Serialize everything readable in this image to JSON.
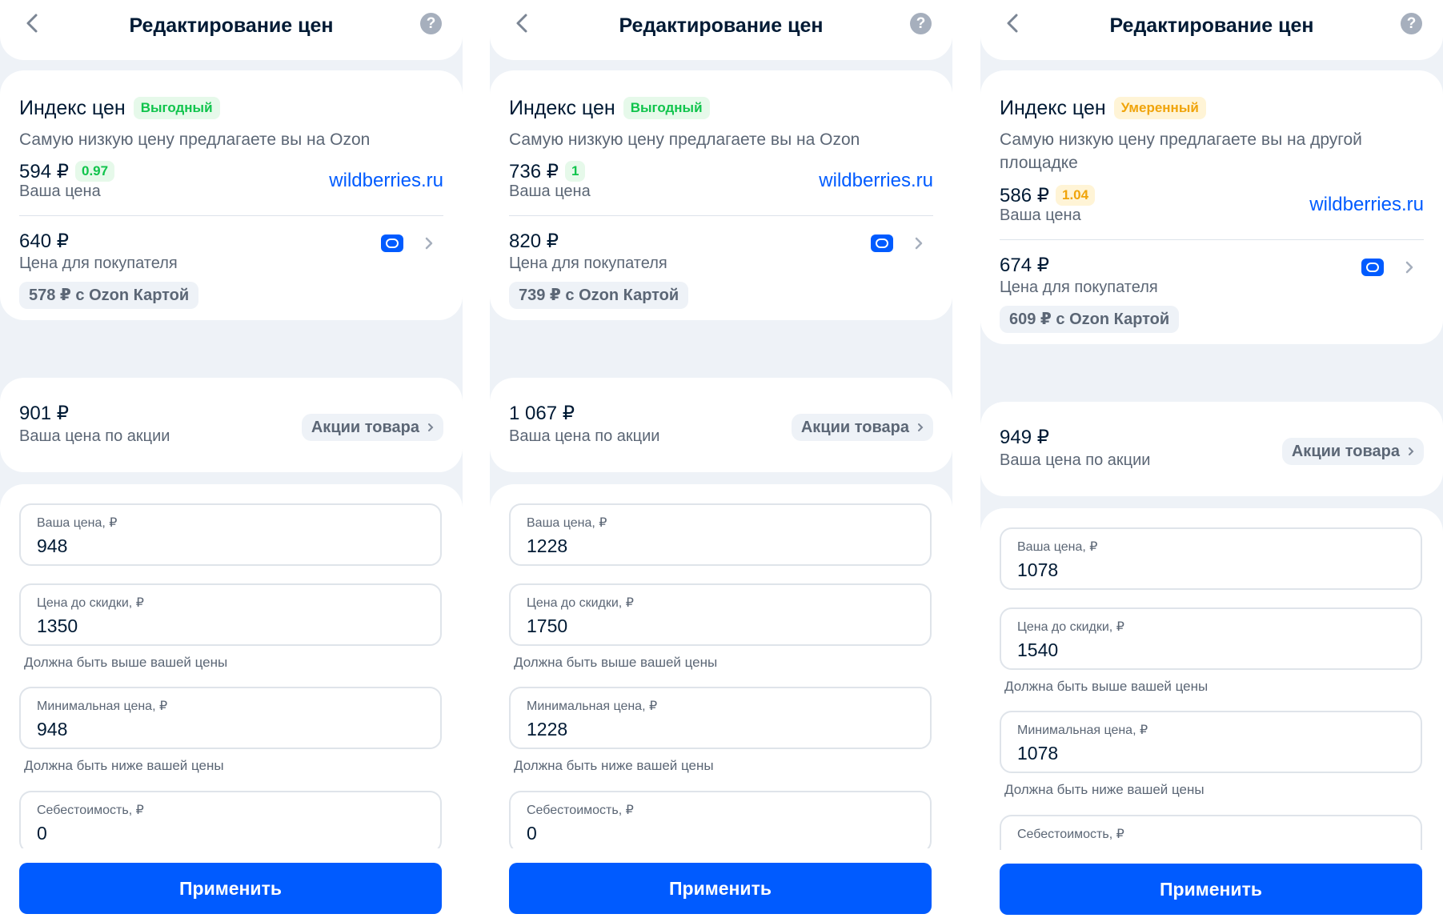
{
  "screens": [
    {
      "header": {
        "title": "Редактирование цен",
        "help_label": "?"
      },
      "price_index": {
        "label": "Индекс цен",
        "status": "Выгодный",
        "description": "Самую низкую цену предлагаете вы на Ozon"
      },
      "your_price": {
        "value": "594 ₽",
        "coef": "0.97",
        "label": "Ваша цена",
        "competitor": "wildberries.ru"
      },
      "buyer_price": {
        "value": "640 ₽",
        "label": "Цена для покупателя",
        "card_price": "578 ₽ с Ozon Картой"
      },
      "promo": {
        "value": "901 ₽",
        "label": "Ваша цена по акции",
        "button": "Акции товара"
      },
      "form": {
        "your_price_label": "Ваша цена, ₽",
        "your_price_value": "948",
        "before_discount_label": "Цена до скидки, ₽",
        "before_discount_value": "1350",
        "before_discount_hint": "Должна быть выше вашей цены",
        "min_price_label": "Минимальная цена, ₽",
        "min_price_value": "948",
        "min_price_hint": "Должна быть ниже вашей цены",
        "cost_label": "Себестоимость, ₽",
        "cost_value": "0"
      },
      "apply_label": "Применить"
    },
    {
      "header": {
        "title": "Редактирование цен",
        "help_label": "?"
      },
      "price_index": {
        "label": "Индекс цен",
        "status": "Выгодный",
        "description": "Самую низкую цену предлагаете вы на Ozon"
      },
      "your_price": {
        "value": "736 ₽",
        "coef": "1",
        "label": "Ваша цена",
        "competitor": "wildberries.ru"
      },
      "buyer_price": {
        "value": "820 ₽",
        "label": "Цена для покупателя",
        "card_price": "739 ₽ с Ozon Картой"
      },
      "promo": {
        "value": "1 067 ₽",
        "label": "Ваша цена по акции",
        "button": "Акции товара"
      },
      "form": {
        "your_price_label": "Ваша цена, ₽",
        "your_price_value": "1228",
        "before_discount_label": "Цена до скидки, ₽",
        "before_discount_value": "1750",
        "before_discount_hint": "Должна быть выше вашей цены",
        "min_price_label": "Минимальная цена, ₽",
        "min_price_value": "1228",
        "min_price_hint": "Должна быть ниже вашей цены",
        "cost_label": "Себестоимость, ₽",
        "cost_value": "0"
      },
      "apply_label": "Применить"
    },
    {
      "header": {
        "title": "Редактирование цен",
        "help_label": "?"
      },
      "price_index": {
        "label": "Индекс цен",
        "status": "Умеренный",
        "description": "Самую низкую цену предлагаете вы на другой площадке"
      },
      "your_price": {
        "value": "586 ₽",
        "coef": "1.04",
        "label": "Ваша цена",
        "competitor": "wildberries.ru"
      },
      "buyer_price": {
        "value": "674 ₽",
        "label": "Цена для покупателя",
        "card_price": "609 ₽ с Ozon Картой"
      },
      "promo": {
        "value": "949 ₽",
        "label": "Ваша цена по акции",
        "button": "Акции товара"
      },
      "form": {
        "your_price_label": "Ваша цена, ₽",
        "your_price_value": "1078",
        "before_discount_label": "Цена до скидки, ₽",
        "before_discount_value": "1540",
        "before_discount_hint": "Должна быть выше вашей цены",
        "min_price_label": "Минимальная цена, ₽",
        "min_price_value": "1078",
        "min_price_hint": "Должна быть ниже вашей цены",
        "cost_label": "Себестоимость, ₽"
      },
      "apply_label": "Применить"
    }
  ],
  "colors": {
    "accent": "#005bff",
    "good": "#10c44c",
    "moderate": "#f0a40a",
    "text": "#001a34",
    "muted": "#5b6675",
    "background": "#eef2f7"
  },
  "icons": {
    "back": "chevron-left-icon",
    "help": "question-circle-icon",
    "ozon": "ozon-logo-icon",
    "chevron": "chevron-right-icon"
  }
}
